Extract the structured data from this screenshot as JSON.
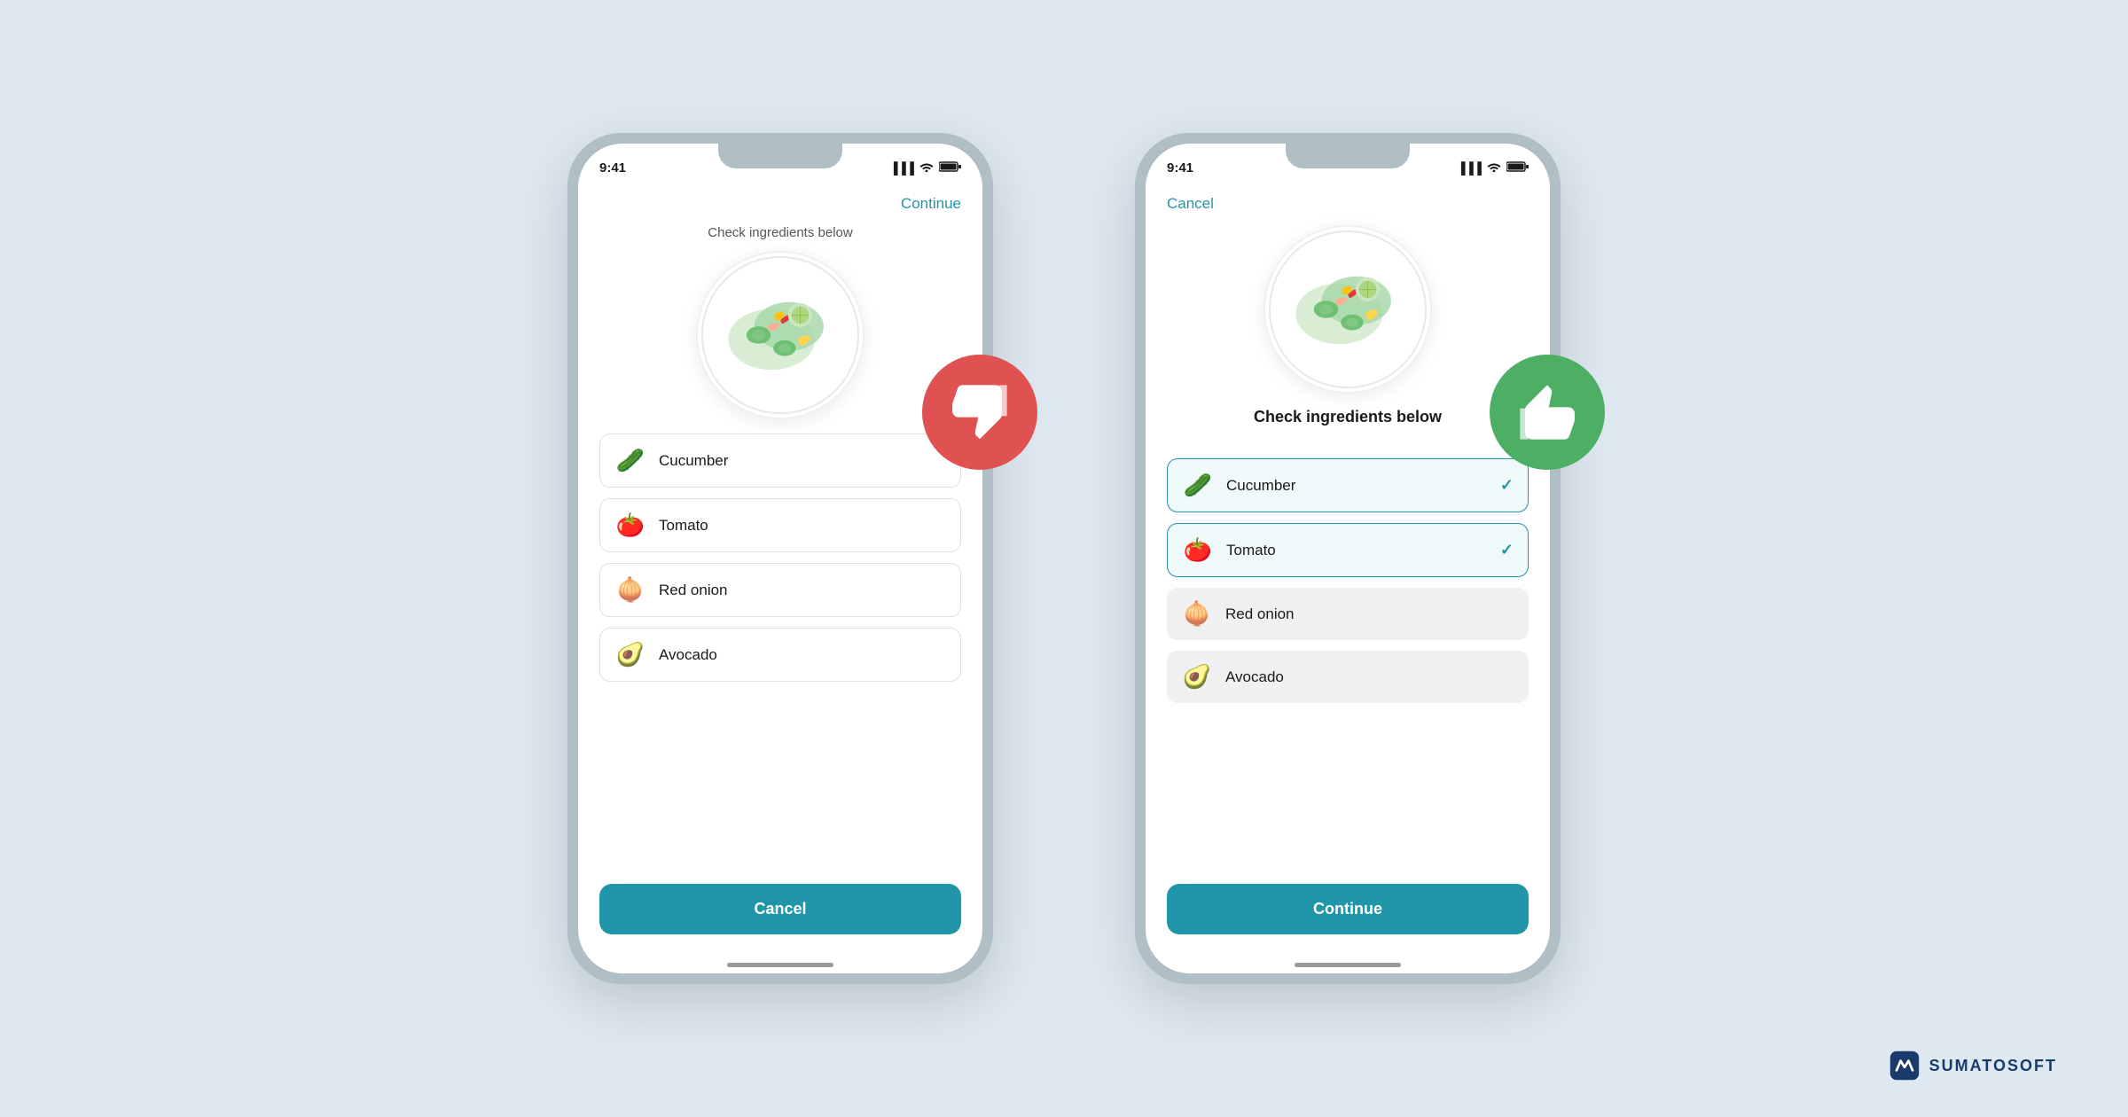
{
  "background_color": "#dde8f0",
  "accent_color": "#2196A8",
  "phone_bad": {
    "status_time": "9:41",
    "status_signal": "▐▐▐",
    "status_wifi": "WiFi",
    "status_battery": "🔋",
    "nav_cancel": "",
    "nav_continue": "Continue",
    "section_title": "Check ingredients below",
    "ingredients": [
      {
        "icon": "🥒",
        "name": "Cucumber",
        "selected": false
      },
      {
        "icon": "🍅",
        "name": "Tomato",
        "selected": false
      },
      {
        "icon": "🧅",
        "name": "Red onion",
        "selected": false
      },
      {
        "icon": "🥑",
        "name": "Avocado",
        "selected": false
      }
    ],
    "button_label": "Cancel",
    "badge_type": "bad"
  },
  "phone_good": {
    "status_time": "9:41",
    "nav_cancel": "Cancel",
    "nav_continue": "",
    "section_title": "Check ingredients below",
    "ingredients": [
      {
        "icon": "🥒",
        "name": "Cucumber",
        "selected": true
      },
      {
        "icon": "🍅",
        "name": "Tomato",
        "selected": true
      },
      {
        "icon": "🧅",
        "name": "Red onion",
        "selected": false
      },
      {
        "icon": "🥑",
        "name": "Avocado",
        "selected": false
      }
    ],
    "button_label": "Continue",
    "badge_type": "good"
  },
  "branding": {
    "name": "SUMATOSOFT"
  }
}
